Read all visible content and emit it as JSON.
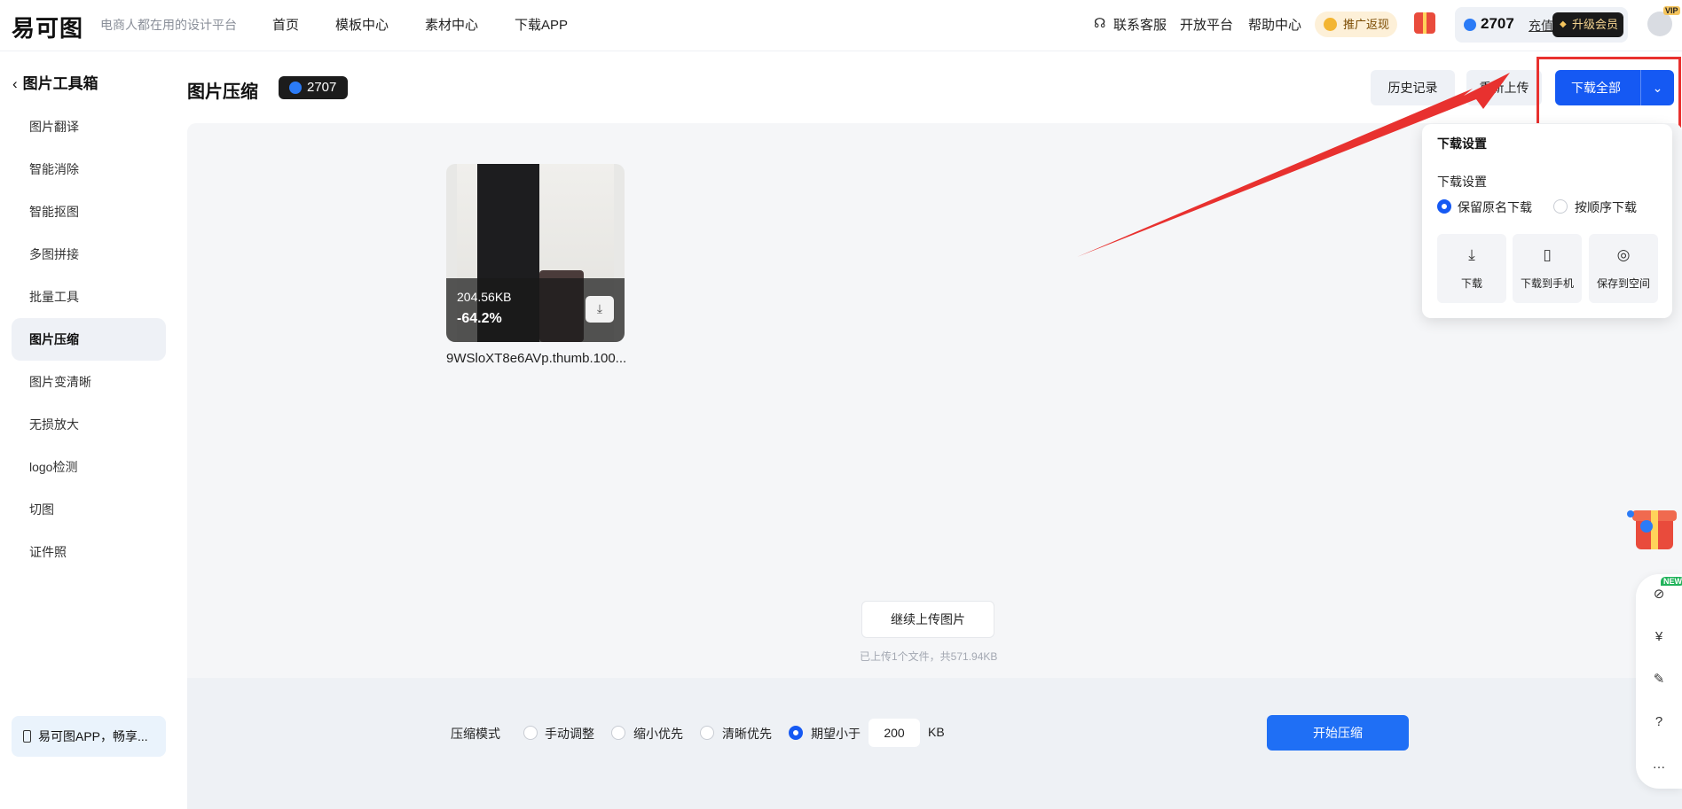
{
  "header": {
    "logo": "易可图",
    "slogan": "电商人都在用的设计平台",
    "nav": [
      "首页",
      "模板中心",
      "素材中心",
      "下载APP"
    ],
    "service": "联系客服",
    "platform": "开放平台",
    "help": "帮助中心",
    "promo": "推广返现",
    "credits": "2707",
    "recharge": "充值",
    "upgrade": "升级会员"
  },
  "sidebar": {
    "title": "图片工具箱",
    "items": [
      "图片翻译",
      "智能消除",
      "智能抠图",
      "多图拼接",
      "批量工具",
      "图片压缩",
      "图片变清晰",
      "无损放大",
      "logo检测",
      "切图",
      "证件照"
    ],
    "active_index": 5,
    "app_promo": "易可图APP，畅享..."
  },
  "main": {
    "title": "图片压缩",
    "credits": "2707",
    "history": "历史记录",
    "reupload": "重新上传",
    "download_all": "下载全部"
  },
  "file": {
    "size": "204.56KB",
    "ratio": "-64.2%",
    "name": "9WSloXT8e6AVp.thumb.100..."
  },
  "upload": {
    "more": "继续上传图片",
    "info": "已上传1个文件，共571.94KB"
  },
  "compress": {
    "mode_label": "压缩模式",
    "options": [
      "手动调整",
      "缩小优先",
      "清晰优先",
      "期望小于"
    ],
    "selected_index": 3,
    "target_value": "200",
    "unit": "KB",
    "start": "开始压缩"
  },
  "dropdown": {
    "title": "下载设置",
    "subtitle": "下载设置",
    "radio_options": [
      "保留原名下载",
      "按顺序下载"
    ],
    "selected_index": 0,
    "actions": [
      {
        "label": "下载",
        "icon": "download-icon"
      },
      {
        "label": "下载到手机",
        "icon": "phone-icon"
      },
      {
        "label": "保存到空间",
        "icon": "user-circle-icon"
      }
    ]
  },
  "float_tools": {
    "new_badge": "NEW"
  },
  "colors": {
    "primary": "#1559f3",
    "annotation": "#e8312f"
  }
}
